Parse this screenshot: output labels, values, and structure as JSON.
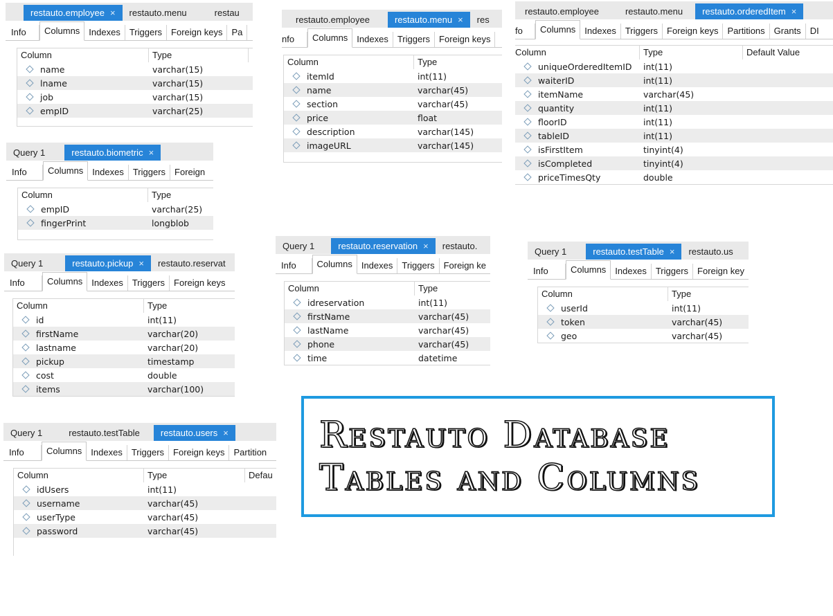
{
  "banner": {
    "line1": "Restauto Database",
    "line2": "Tables and Columns"
  },
  "panels": [
    {
      "id": "employee",
      "left": "",
      "tabs": [
        {
          "label": "restauto.employee",
          "active": true
        },
        {
          "label": "restauto.menu",
          "active": false
        },
        {
          "label": "restau",
          "active": false
        }
      ],
      "subtabs": [
        "Info",
        "Columns",
        "Indexes",
        "Triggers",
        "Foreign keys",
        "Pa"
      ],
      "headers": [
        "Column",
        "Type"
      ],
      "rows": [
        [
          "name",
          "varchar(15)"
        ],
        [
          "lname",
          "varchar(15)"
        ],
        [
          "job",
          "varchar(15)"
        ],
        [
          "empID",
          "varchar(25)"
        ]
      ]
    },
    {
      "id": "menu",
      "tabs": [
        {
          "label": "restauto.employee",
          "active": false
        },
        {
          "label": "restauto.menu",
          "active": true
        },
        {
          "label": "res",
          "active": false
        }
      ],
      "subtabs": [
        "nfo",
        "Columns",
        "Indexes",
        "Triggers",
        "Foreign keys"
      ],
      "headers": [
        "Column",
        "Type"
      ],
      "rows": [
        [
          "itemId",
          "int(11)"
        ],
        [
          "name",
          "varchar(45)"
        ],
        [
          "section",
          "varchar(45)"
        ],
        [
          "price",
          "float"
        ],
        [
          "description",
          "varchar(145)"
        ],
        [
          "imageURL",
          "varchar(145)"
        ]
      ]
    },
    {
      "id": "ordereditem",
      "tabs": [
        {
          "label": "restauto.employee",
          "active": false
        },
        {
          "label": "restauto.menu",
          "active": false
        },
        {
          "label": "restauto.orderedItem",
          "active": true
        }
      ],
      "subtabs": [
        "fo",
        "Columns",
        "Indexes",
        "Triggers",
        "Foreign keys",
        "Partitions",
        "Grants",
        "DI"
      ],
      "headers": [
        "Column",
        "Type",
        "Default Value"
      ],
      "rows": [
        [
          "uniqueOrderedItemID",
          "int(11)"
        ],
        [
          "waiterID",
          "int(11)"
        ],
        [
          "itemName",
          "varchar(45)"
        ],
        [
          "quantity",
          "int(11)"
        ],
        [
          "floorID",
          "int(11)"
        ],
        [
          "tableID",
          "int(11)"
        ],
        [
          "isFirstItem",
          "tinyint(4)"
        ],
        [
          "isCompleted",
          "tinyint(4)"
        ],
        [
          "priceTimesQty",
          "double"
        ]
      ]
    },
    {
      "id": "biometric",
      "tabs": [
        {
          "label": "Query 1",
          "active": false
        },
        {
          "label": "restauto.biometric",
          "active": true
        }
      ],
      "subtabs": [
        "Info",
        "Columns",
        "Indexes",
        "Triggers",
        "Foreign"
      ],
      "headers": [
        "Column",
        "Type"
      ],
      "rows": [
        [
          "empID",
          "varchar(25)"
        ],
        [
          "fingerPrint",
          "longblob"
        ]
      ]
    },
    {
      "id": "pickup",
      "tabs": [
        {
          "label": "Query 1",
          "active": false
        },
        {
          "label": "restauto.pickup",
          "active": true
        },
        {
          "label": "restauto.reservat",
          "active": false
        }
      ],
      "subtabs": [
        "Info",
        "Columns",
        "Indexes",
        "Triggers",
        "Foreign keys"
      ],
      "headers": [
        "Column",
        "Type"
      ],
      "rows": [
        [
          "id",
          "int(11)"
        ],
        [
          "firstName",
          "varchar(20)"
        ],
        [
          "lastname",
          "varchar(20)"
        ],
        [
          "pickup",
          "timestamp"
        ],
        [
          "cost",
          "double"
        ],
        [
          "items",
          "varchar(100)"
        ]
      ]
    },
    {
      "id": "reservation",
      "tabs": [
        {
          "label": "Query 1",
          "active": false
        },
        {
          "label": "restauto.reservation",
          "active": true
        },
        {
          "label": "restauto.",
          "active": false
        }
      ],
      "subtabs": [
        "Info",
        "Columns",
        "Indexes",
        "Triggers",
        "Foreign ke"
      ],
      "headers": [
        "Column",
        "Type"
      ],
      "rows": [
        [
          "idreservation",
          "int(11)"
        ],
        [
          "firstName",
          "varchar(45)"
        ],
        [
          "lastName",
          "varchar(45)"
        ],
        [
          "phone",
          "varchar(45)"
        ],
        [
          "time",
          "datetime"
        ]
      ]
    },
    {
      "id": "testtable",
      "tabs": [
        {
          "label": "Query 1",
          "active": false
        },
        {
          "label": "restauto.testTable",
          "active": true
        },
        {
          "label": "restauto.us",
          "active": false
        }
      ],
      "subtabs": [
        "Info",
        "Columns",
        "Indexes",
        "Triggers",
        "Foreign key"
      ],
      "headers": [
        "Column",
        "Type"
      ],
      "rows": [
        [
          "userId",
          "int(11)"
        ],
        [
          "token",
          "varchar(45)"
        ],
        [
          "geo",
          "varchar(45)"
        ]
      ]
    },
    {
      "id": "users",
      "tabs": [
        {
          "label": "Query 1",
          "active": false
        },
        {
          "label": "restauto.testTable",
          "active": false
        },
        {
          "label": "restauto.users",
          "active": true
        }
      ],
      "subtabs": [
        "Info",
        "Columns",
        "Indexes",
        "Triggers",
        "Foreign keys",
        "Partition"
      ],
      "headers": [
        "Column",
        "Type",
        "Defau"
      ],
      "rows": [
        [
          "idUsers",
          "int(11)"
        ],
        [
          "username",
          "varchar(45)"
        ],
        [
          "userType",
          "varchar(45)"
        ],
        [
          "password",
          "varchar(45)"
        ]
      ]
    }
  ]
}
